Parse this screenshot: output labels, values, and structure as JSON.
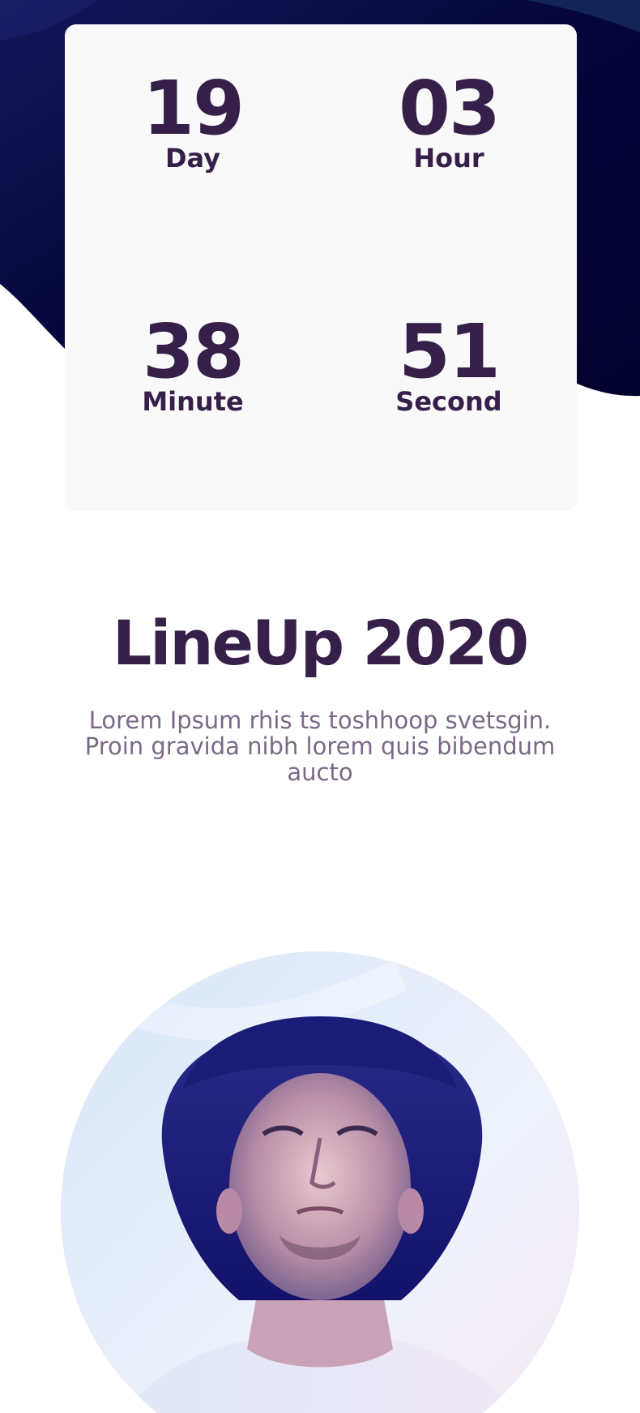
{
  "countdown": {
    "day": {
      "value": "19",
      "label": "Day"
    },
    "hour": {
      "value": "03",
      "label": "Hour"
    },
    "minute": {
      "value": "38",
      "label": "Minute"
    },
    "second": {
      "value": "51",
      "label": "Second"
    }
  },
  "lineup": {
    "title": "LineUp 2020",
    "description": "Lorem Ipsum rhis ts toshhoop svetsgin. Proin gravida nibh lorem quis bibendum aucto"
  },
  "colors": {
    "heading": "#36204a",
    "body_text": "#7a6a86",
    "hero_dark": "#07063a",
    "card_bg": "#faf9fa"
  }
}
